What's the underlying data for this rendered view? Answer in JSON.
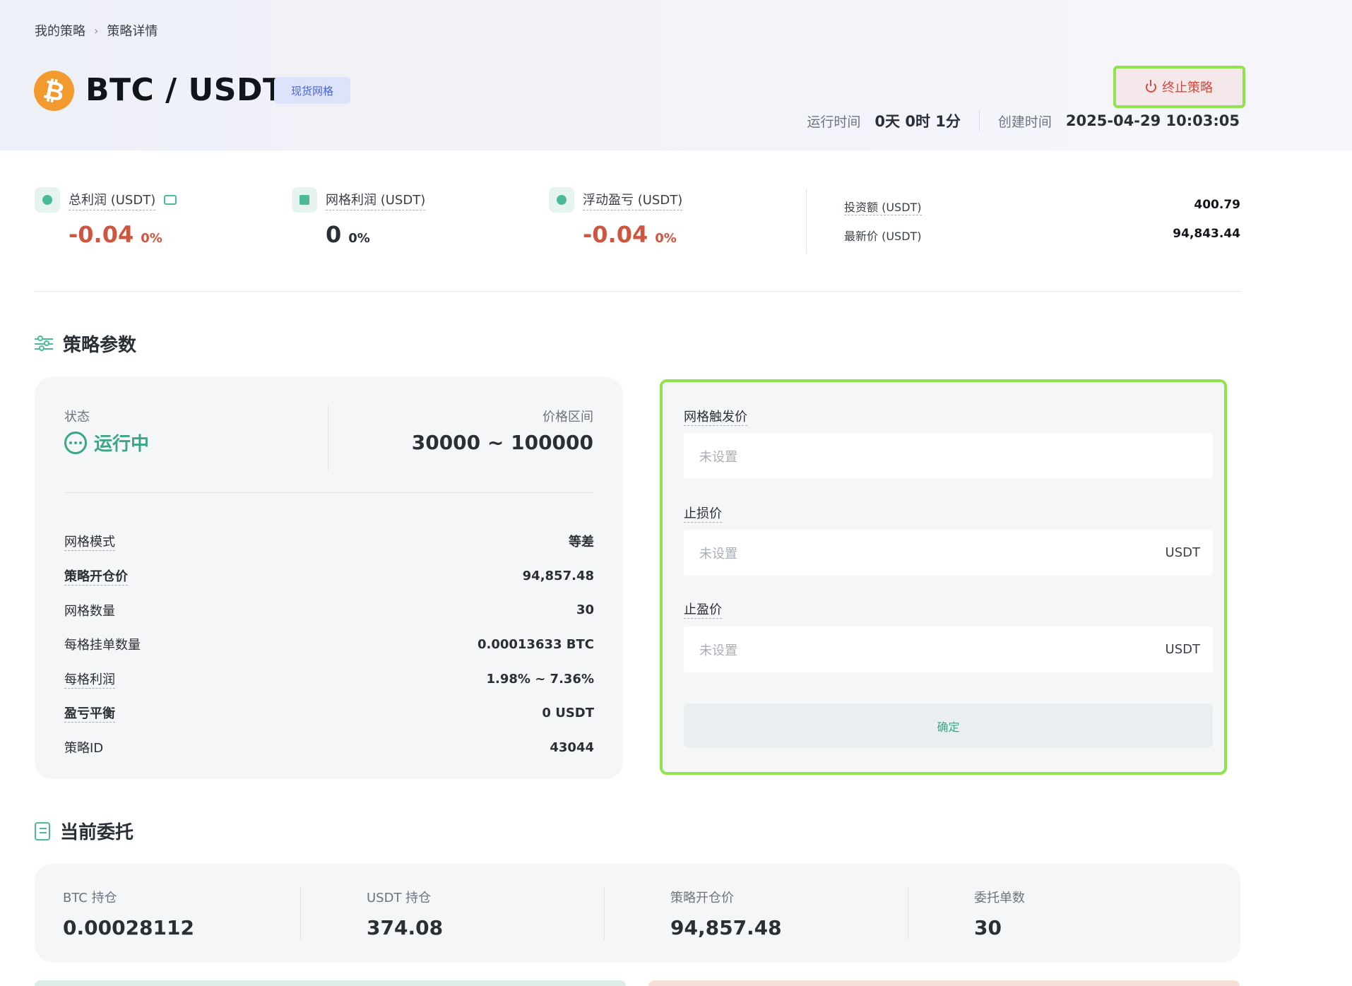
{
  "breadcrumb": {
    "parent": "我的策略",
    "current": "策略详情"
  },
  "header": {
    "coin_icon": "bitcoin-icon",
    "pair": "BTC / USDT",
    "tag": "现货网格",
    "stop_button": "终止策略",
    "run_time_label": "运行时间",
    "run_time_value": "0天 0时 1分",
    "created_label": "创建时间",
    "created_value": "2025-04-29 10:03:05"
  },
  "stats": {
    "total_profit": {
      "label": "总利润 (USDT)",
      "value": "-0.04",
      "pct": "0%"
    },
    "grid_profit": {
      "label": "网格利润 (USDT)",
      "value": "0",
      "pct": "0%"
    },
    "floating_pnl": {
      "label": "浮动盈亏 (USDT)",
      "value": "-0.04",
      "pct": "0%"
    },
    "investment": {
      "label": "投资额 (USDT)",
      "value": "400.79"
    },
    "latest_price": {
      "label": "最新价 (USDT)",
      "value": "94,843.44"
    }
  },
  "strategy_params": {
    "title": "策略参数",
    "status_label": "状态",
    "status_value": "运行中",
    "range_label": "价格区间",
    "range_value": "30000 ~ 100000",
    "rows": [
      {
        "label": "网格模式",
        "value": "等差"
      },
      {
        "label": "策略开仓价",
        "value": "94,857.48"
      },
      {
        "label": "网格数量",
        "value": "30"
      },
      {
        "label": "每格挂单数量",
        "value": "0.00013633 BTC"
      },
      {
        "label": "每格利润",
        "value": "1.98% ~ 7.36%"
      },
      {
        "label": "盈亏平衡",
        "value": "0  USDT"
      },
      {
        "label": "策略ID",
        "value": "43044"
      }
    ]
  },
  "trigger_form": {
    "trigger_label": "网格触发价",
    "trigger_placeholder": "未设置",
    "stop_loss_label": "止损价",
    "stop_loss_placeholder": "未设置",
    "stop_loss_unit": "USDT",
    "take_profit_label": "止盈价",
    "take_profit_placeholder": "未设置",
    "take_profit_unit": "USDT",
    "confirm": "确定"
  },
  "orders": {
    "title": "当前委托",
    "cols": [
      {
        "label": "BTC 持仓",
        "value": "0.00028112"
      },
      {
        "label": "USDT 持仓",
        "value": "374.08"
      },
      {
        "label": "策略开仓价",
        "value": "94,857.48"
      },
      {
        "label": "委托单数",
        "value": "30"
      }
    ]
  },
  "colors": {
    "accent": "#3aa687",
    "negative": "#d0553f",
    "highlight": "#8fe34e",
    "coin": "#f39a2e"
  }
}
